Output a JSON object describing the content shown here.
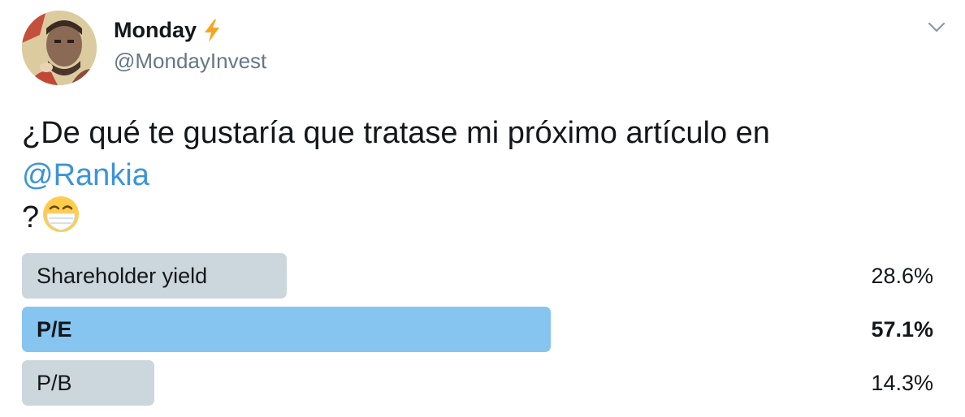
{
  "author": {
    "display_name": "Monday",
    "verified_emoji": "lightning-bolt-icon",
    "handle": "@MondayInvest",
    "avatar": "avatar-photo"
  },
  "menu_icon": "chevron-down-icon",
  "tweet": {
    "line1": "¿De qué te gustaría que tratase mi próximo artículo en",
    "mention": "@Rankia",
    "line3_prefix": "?",
    "emoji": "face-with-medical-mask-icon"
  },
  "poll": {
    "options": [
      {
        "label": "Shareholder yield",
        "percent_text": "28.6%",
        "percent": 28.6,
        "winner": false
      },
      {
        "label": "P/E",
        "percent_text": "57.1%",
        "percent": 57.1,
        "winner": true
      },
      {
        "label": "P/B",
        "percent_text": "14.3%",
        "percent": 14.3,
        "winner": false
      }
    ]
  },
  "colors": {
    "bar_default": "#ccd6dd",
    "bar_winner": "#86c5f0",
    "link": "#3b94d9",
    "secondary_text": "#657786"
  }
}
